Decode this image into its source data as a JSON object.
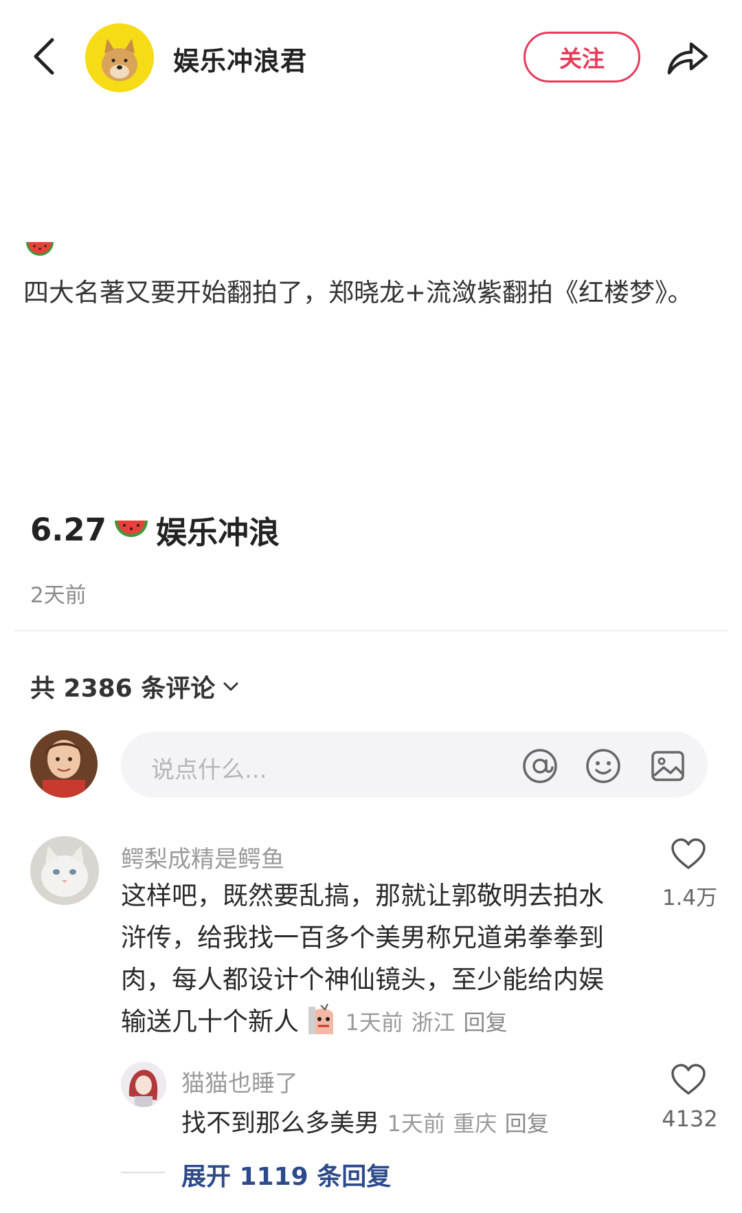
{
  "header": {
    "author_name": "娱乐冲浪君",
    "follow_label": "关注"
  },
  "post": {
    "text": "四大名著又要开始翻拍了，郑晓龙+流潋紫翻拍《红楼梦》。",
    "title_date": "6.27",
    "title_text": "娱乐冲浪",
    "time": "2天前"
  },
  "comments_header": {
    "count_label": "共 2386 条评论"
  },
  "comment_input": {
    "placeholder": "说点什么..."
  },
  "comments": [
    {
      "user": "鳄梨成精是鳄鱼",
      "text": "这样吧，既然要乱搞，那就让郭敬明去拍水浒传，给我找一百多个美男称兄道弟拳拳到肉，每人都设计个神仙镜头，至少能给内娱输送几十个新人",
      "time": "1天前",
      "location": "浙江",
      "reply_label": "回复",
      "likes": "1.4万",
      "replies": [
        {
          "user": "猫猫也睡了",
          "text": "找不到那么多美男",
          "time": "1天前",
          "location": "重庆",
          "reply_label": "回复",
          "likes": "4132"
        }
      ],
      "expand_label": "展开 1119 条回复"
    }
  ],
  "colors": {
    "accent": "#e8395a",
    "link": "#2c4a8a",
    "muted": "#9a9a9a"
  },
  "icons": {
    "back": "chevron-left-icon",
    "share": "share-arrow-icon",
    "at": "at-icon",
    "emoji": "smile-icon",
    "image": "image-icon",
    "like": "heart-icon",
    "post_emoji": "watermelon-icon"
  }
}
